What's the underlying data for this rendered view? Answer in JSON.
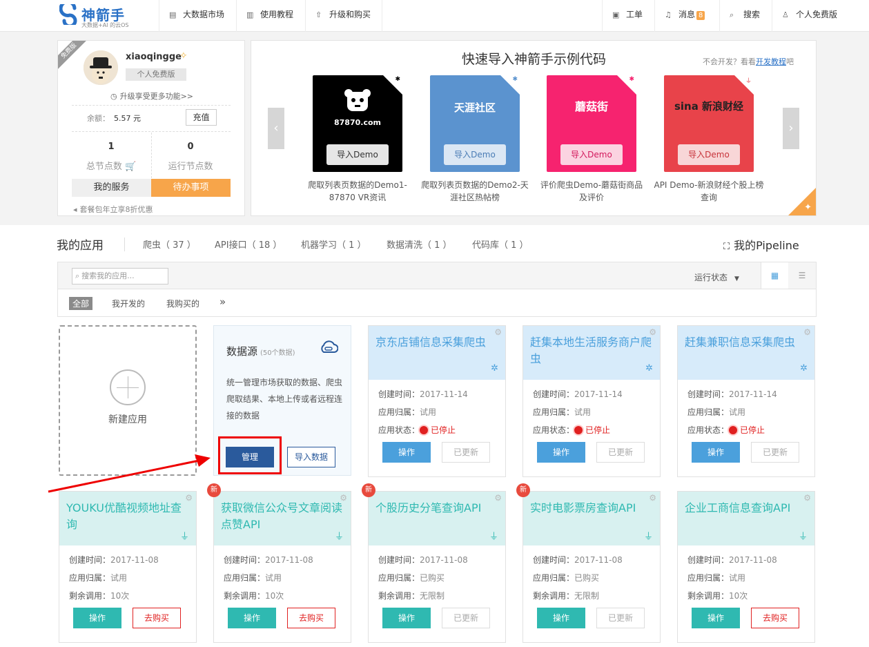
{
  "brand": {
    "name": "神箭手",
    "tagline": "大数据+AI 的云OS"
  },
  "nav": {
    "left": [
      "大数据市场",
      "使用教程",
      "升级和购买"
    ],
    "right": {
      "ticket": "工单",
      "messages": "消息",
      "message_count": "8",
      "search": "搜索",
      "account": "个人免费版"
    }
  },
  "user": {
    "ribbon": "免费版",
    "username": "xiaoqingge",
    "plan": "个人免费版",
    "upgrade": "升级享受更多功能>>",
    "balance_label": "余额：",
    "balance_value": "5.57 元",
    "recharge": "充值",
    "total_nodes": "1",
    "total_nodes_label": "总节点数",
    "running_nodes": "0",
    "running_nodes_label": "运行节点数",
    "my_services": "我的服务",
    "todo": "待办事项",
    "promo": "套餐包年立享8折优惠"
  },
  "demo": {
    "title": "快速导入神箭手示例代码",
    "sub_prefix": "不会开发？看看",
    "sub_link": "开发教程",
    "sub_suffix": "吧",
    "import_label": "导入Demo",
    "tiles": [
      {
        "logo": "87870.com",
        "caption": "爬取列表页数据的Demo1-87870 VR资讯",
        "bg": "#000000"
      },
      {
        "logo": "天涯社区",
        "caption": "爬取列表页数据的Demo2-天涯社区热帖榜",
        "bg": "#5b93cf"
      },
      {
        "logo": "蘑菇街",
        "caption": "评价爬虫Demo-蘑菇街商品及评价",
        "bg": "#f6236f"
      },
      {
        "logo": "sina 新浪财经",
        "caption": "API Demo-新浪财经个股上榜查询",
        "bg": "#e8434a"
      }
    ]
  },
  "apps": {
    "title": "我的应用",
    "tabs": [
      "爬虫（ 37 ）",
      "API接口（ 18 ）",
      "机器学习（ 1 ）",
      "数据清洗（ 1 ）",
      "代码库（ 1 ）"
    ],
    "pipeline": "我的Pipeline",
    "search_placeholder": "搜索我的应用...",
    "run_status": "运行状态",
    "filters": [
      "全部",
      "我开发的",
      "我购买的"
    ],
    "new_app": "新建应用",
    "datasource": {
      "title": "数据源",
      "count": "(50个数据)",
      "desc": "统一管理市场获取的数据、爬虫爬取结果、本地上传或者远程连接的数据",
      "manage": "管理",
      "import": "导入数据"
    },
    "labels": {
      "created": "创建时间：",
      "owner": "应用归属：",
      "status": "应用状态：",
      "remaining": "剩余调用：",
      "op": "操作",
      "updated": "已更新",
      "buy": "去购买",
      "new": "新"
    },
    "crawlers": [
      {
        "title": "京东店铺信息采集爬虫",
        "created": "2017-11-14",
        "owner": "试用",
        "status": "已停止"
      },
      {
        "title": "赶集本地生活服务商户爬虫",
        "created": "2017-11-14",
        "owner": "试用",
        "status": "已停止"
      },
      {
        "title": "赶集兼职信息采集爬虫",
        "created": "2017-11-14",
        "owner": "试用",
        "status": "已停止"
      }
    ],
    "apis": [
      {
        "title": "YOUKU优酷视频地址查询",
        "created": "2017-11-08",
        "owner": "试用",
        "remaining": "10次",
        "action": "去购买",
        "new": false
      },
      {
        "title": "获取微信公众号文章阅读点赞API",
        "created": "2017-11-08",
        "owner": "试用",
        "remaining": "10次",
        "action": "去购买",
        "new": true
      },
      {
        "title": "个股历史分笔查询API",
        "created": "2017-11-08",
        "owner": "已购买",
        "remaining": "无限制",
        "action": "已更新",
        "new": true
      },
      {
        "title": "实时电影票房查询API",
        "created": "2017-11-08",
        "owner": "已购买",
        "remaining": "无限制",
        "action": "已更新",
        "new": true
      },
      {
        "title": "企业工商信息查询API",
        "created": "2017-11-08",
        "owner": "试用",
        "remaining": "10次",
        "action": "去购买",
        "new": false
      }
    ]
  },
  "colors": {
    "brand_blue": "#2a71c6",
    "orange": "#f7a54a",
    "crawler_blue": "#4ba0dc",
    "api_teal": "#2fb9b1",
    "red": "#e02020"
  }
}
